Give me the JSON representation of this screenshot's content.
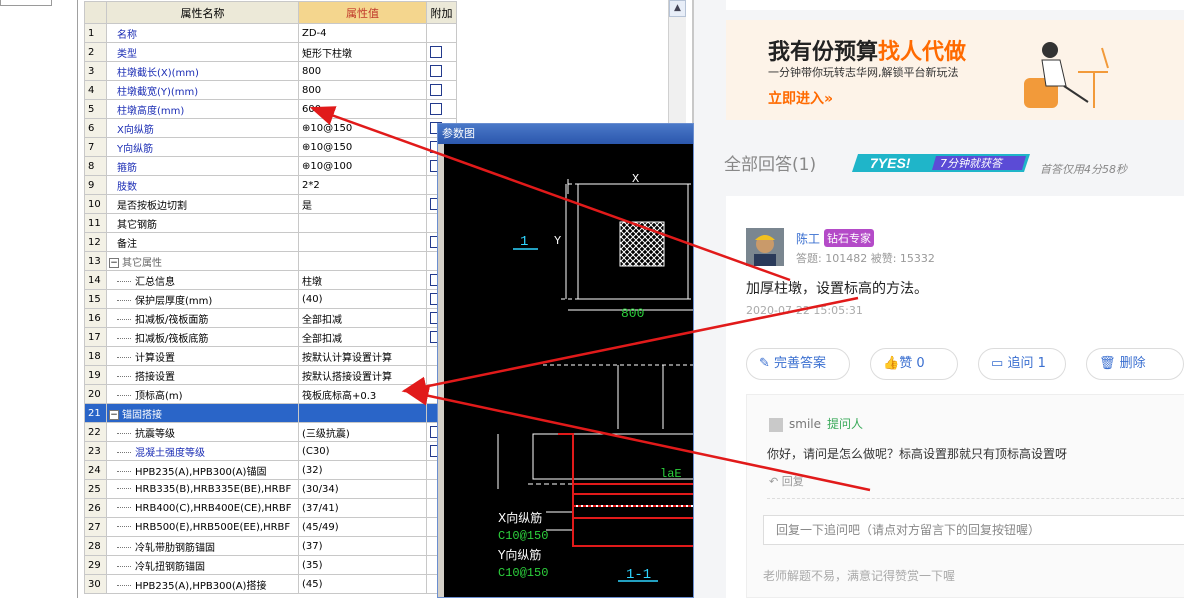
{
  "table": {
    "header": {
      "name": "属性名称",
      "value": "属性值",
      "add": "附加"
    },
    "rows": [
      {
        "n": "1",
        "name": "名称",
        "value": "ZD-4",
        "blue": true,
        "check": false,
        "indent": 0
      },
      {
        "n": "2",
        "name": "类型",
        "value": "矩形下柱墩",
        "blue": true,
        "check": true,
        "indent": 0
      },
      {
        "n": "3",
        "name": "柱墩截长(X)(mm)",
        "value": "800",
        "blue": true,
        "check": true,
        "indent": 0
      },
      {
        "n": "4",
        "name": "柱墩截宽(Y)(mm)",
        "value": "800",
        "blue": true,
        "check": true,
        "indent": 0
      },
      {
        "n": "5",
        "name": "柱墩高度(mm)",
        "value": "600",
        "blue": true,
        "check": true,
        "indent": 0
      },
      {
        "n": "6",
        "name": "X向纵筋",
        "value": "⊕10@150",
        "blue": true,
        "check": true,
        "indent": 0
      },
      {
        "n": "7",
        "name": "Y向纵筋",
        "value": "⊕10@150",
        "blue": true,
        "check": true,
        "indent": 0
      },
      {
        "n": "8",
        "name": "箍筋",
        "value": "⊕10@100",
        "blue": true,
        "check": true,
        "indent": 0
      },
      {
        "n": "9",
        "name": "肢数",
        "value": "2*2",
        "blue": true,
        "check": false,
        "indent": 0
      },
      {
        "n": "10",
        "name": "是否按板边切割",
        "value": "是",
        "blue": false,
        "check": true,
        "indent": 0
      },
      {
        "n": "11",
        "name": "其它钢筋",
        "value": "",
        "blue": false,
        "check": false,
        "indent": 0
      },
      {
        "n": "12",
        "name": "备注",
        "value": "",
        "blue": false,
        "check": true,
        "indent": 0
      },
      {
        "n": "13",
        "name": "其它属性",
        "value": "",
        "blue": false,
        "check": false,
        "indent": 0,
        "expander": "−",
        "gray": true
      },
      {
        "n": "14",
        "name": "汇总信息",
        "value": "柱墩",
        "blue": false,
        "check": true,
        "indent": 1
      },
      {
        "n": "15",
        "name": "保护层厚度(mm)",
        "value": "(40)",
        "blue": false,
        "check": true,
        "indent": 1
      },
      {
        "n": "16",
        "name": "扣减板/筏板面筋",
        "value": "全部扣减",
        "blue": false,
        "check": true,
        "indent": 1
      },
      {
        "n": "17",
        "name": "扣减板/筏板底筋",
        "value": "全部扣减",
        "blue": false,
        "check": true,
        "indent": 1
      },
      {
        "n": "18",
        "name": "计算设置",
        "value": "按默认计算设置计算",
        "blue": false,
        "check": false,
        "indent": 1
      },
      {
        "n": "19",
        "name": "搭接设置",
        "value": "按默认搭接设置计算",
        "blue": false,
        "check": false,
        "indent": 1
      },
      {
        "n": "20",
        "name": "顶标高(m)",
        "value": "筏板底标高+0.3",
        "blue": false,
        "check": false,
        "indent": 1
      },
      {
        "n": "21",
        "name": "锚固搭接",
        "value": "",
        "blue": false,
        "check": false,
        "indent": 0,
        "expander": "−",
        "selected": true
      },
      {
        "n": "22",
        "name": "抗震等级",
        "value": "(三级抗震)",
        "blue": false,
        "check": true,
        "indent": 1
      },
      {
        "n": "23",
        "name": "混凝土强度等级",
        "value": "(C30)",
        "blue": true,
        "check": true,
        "indent": 1
      },
      {
        "n": "24",
        "name": "HPB235(A),HPB300(A)锚固",
        "value": "(32)",
        "blue": false,
        "check": false,
        "indent": 1
      },
      {
        "n": "25",
        "name": "HRB335(B),HRB335E(BE),HRBF",
        "value": "(30/34)",
        "blue": false,
        "check": false,
        "indent": 1
      },
      {
        "n": "26",
        "name": "HRB400(C),HRB400E(CE),HRBF",
        "value": "(37/41)",
        "blue": false,
        "check": false,
        "indent": 1
      },
      {
        "n": "27",
        "name": "HRB500(E),HRB500E(EE),HRBF",
        "value": "(45/49)",
        "blue": false,
        "check": false,
        "indent": 1
      },
      {
        "n": "28",
        "name": "冷轧带肋钢筋锚固",
        "value": "(37)",
        "blue": false,
        "check": false,
        "indent": 1
      },
      {
        "n": "29",
        "name": "冷轧扭钢筋锚固",
        "value": "(35)",
        "blue": false,
        "check": false,
        "indent": 1
      },
      {
        "n": "30",
        "name": "HPB235(A),HPB300(A)搭接",
        "value": "(45)",
        "blue": false,
        "check": false,
        "indent": 1
      }
    ]
  },
  "ref_window": {
    "title": "参数图",
    "labels": {
      "section_mark": "1",
      "dim_x": "X",
      "dim_y": "Y",
      "dim_800": "800",
      "lae": "laE",
      "x_bar": "X向纵筋",
      "x_bar_spec": "C10@150",
      "y_bar": "Y向纵筋",
      "y_bar_spec": "C10@150",
      "section_label": "1-1"
    }
  },
  "banner": {
    "t1a": "我有份预算",
    "t1b": "找人代做",
    "t2": "一分钟带你玩转志华网,解锁平台新玩法",
    "t3": "立即进入»"
  },
  "answers": {
    "title": "全部回答(1)",
    "yes_text": "7YES!",
    "yes_sub": "7分钟就获答",
    "quick": "首答仅用4分58秒"
  },
  "answer": {
    "user": "陈工",
    "badge": "钻石专家",
    "stats": "答题: 101482   被赞: 15332",
    "text": "加厚柱墩，设置标高的方法。",
    "date": "2020-07-22 15:05:31",
    "buttons": {
      "complete": "完善答案",
      "like": "赞 0",
      "follow": "追问 1",
      "delete": "删除"
    }
  },
  "followup": {
    "user": "smile",
    "role": "提问人",
    "text": "你好，请问是怎么做呢？标高设置那就只有顶标高设置呀",
    "reply": "回复",
    "input_placeholder": "回复一下追问吧（请点对方留言下的回复按钮喔）",
    "tip": "老师解题不易，满意记得赞赏一下喔"
  },
  "colors": {
    "accent_blue": "#3a6fd0",
    "orange": "#ff6a00",
    "arrow_red": "#e11a1a",
    "select_blue": "#2a65c8"
  },
  "icons": [
    "edit-icon",
    "thumb-up-icon",
    "comment-icon",
    "trash-icon",
    "reply-icon",
    "up-arrow-icon",
    "expand-icon"
  ]
}
